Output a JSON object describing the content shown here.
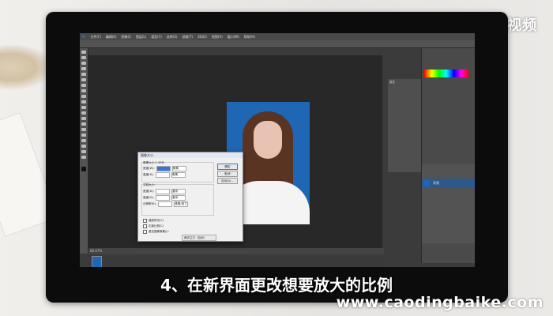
{
  "brand": {
    "logo_text": "天奇·视频",
    "watermark": "www.caodingbaike.com"
  },
  "subtitle": "4、在新界面更改想要放大的比例",
  "colors": {
    "photo_bg": "#1f66b4",
    "canvas_bg": "#282828",
    "ps_chrome": "#4a4a4a"
  },
  "photoshop": {
    "app_icon": "Ps",
    "menu": [
      "文件(F)",
      "编辑(E)",
      "图像(I)",
      "图层(L)",
      "类型(Y)",
      "选择(S)",
      "滤镜(T)",
      "3D(D)",
      "视图(V)",
      "窗口(W)",
      "帮助(H)"
    ],
    "status_zoom": "66.67%",
    "layers_panel": {
      "layer_name": "背景"
    },
    "properties_panel": {
      "title": "属性"
    }
  },
  "dialog": {
    "title": "图像大小",
    "pixel_group": "像素大小:1.39M",
    "rows": [
      {
        "label": "宽度(W):",
        "value": "",
        "unit": "像素"
      },
      {
        "label": "高度(H):",
        "value": "",
        "unit": "像素"
      }
    ],
    "doc_group": "文档大小:",
    "doc_rows": [
      {
        "label": "宽度(D):",
        "value": "",
        "unit": "厘米"
      },
      {
        "label": "高度(G):",
        "value": "",
        "unit": "厘米"
      },
      {
        "label": "分辨率(R):",
        "value": "",
        "unit": "像素/英寸"
      }
    ],
    "buttons": {
      "ok": "确定",
      "cancel": "取消",
      "auto": "自动(A)..."
    },
    "checks": [
      "缩放样式(Y)",
      "约束比例(C)",
      "重定图像像素(I):"
    ],
    "resample": "两次立方（自动）"
  }
}
